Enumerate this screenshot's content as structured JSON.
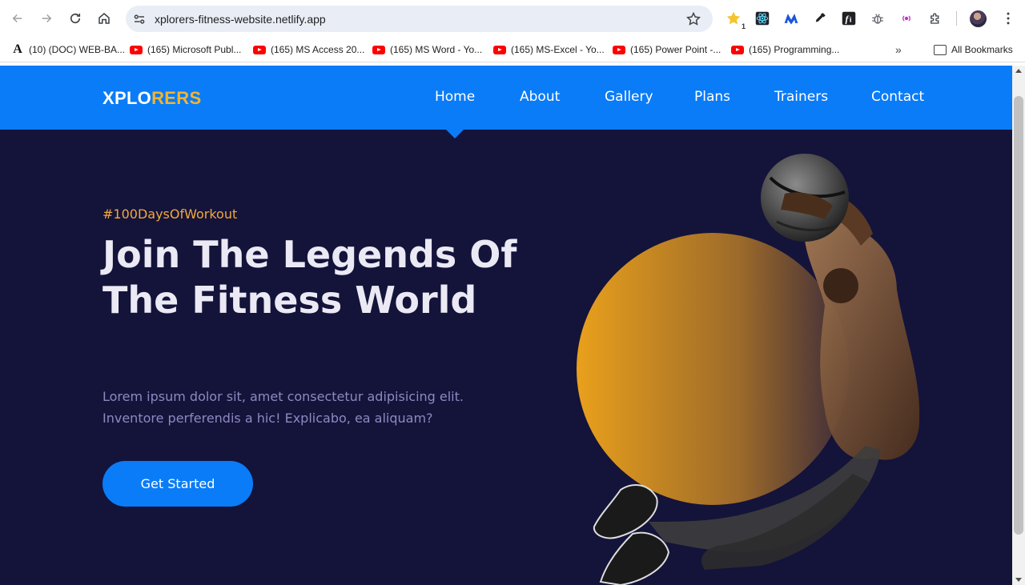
{
  "browser": {
    "url": "xplorers-fitness-website.netlify.app",
    "extension_badge": "1",
    "bookmarks": [
      {
        "label": "(10) (DOC) WEB-BA...",
        "icon": "doc-a-icon"
      },
      {
        "label": "(165) Microsoft Publ...",
        "icon": "youtube-icon"
      },
      {
        "label": "(165) MS Access 20...",
        "icon": "youtube-icon"
      },
      {
        "label": "(165) MS Word - Yo...",
        "icon": "youtube-icon"
      },
      {
        "label": "(165) MS-Excel - Yo...",
        "icon": "youtube-icon"
      },
      {
        "label": "(165) Power Point -...",
        "icon": "youtube-icon"
      },
      {
        "label": "(165) Programming...",
        "icon": "youtube-icon"
      }
    ],
    "more_bookmarks": "»",
    "all_bookmarks": "All Bookmarks"
  },
  "site": {
    "logo_part1": "XPLO",
    "logo_part2": "RERS",
    "nav": [
      "Home",
      "About",
      "Gallery",
      "Plans",
      "Trainers",
      "Contact"
    ],
    "active_nav": "Home",
    "hashtag": "#100DaysOfWorkout",
    "headline": "Join The Legends Of The Fitness World",
    "lead": "Lorem ipsum dolor sit, amet consectetur adipisicing elit. Inventore perferendis a hic! Explicabo, ea aliquam?",
    "cta": "Get Started"
  },
  "colors": {
    "brand_blue": "#0a7cf8",
    "logo_accent": "#f1b52f",
    "hero_bg": "#14133a",
    "hashtag": "#f3a93b",
    "circle_start": "#e9a01c",
    "circle_end": "#3a2a3a"
  }
}
